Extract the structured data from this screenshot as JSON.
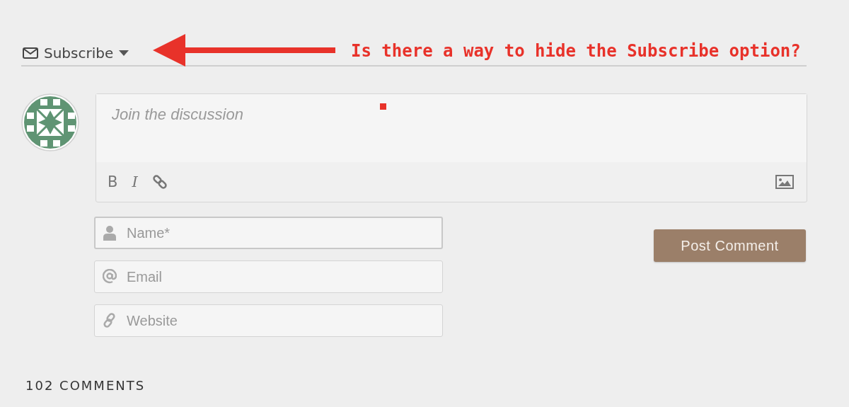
{
  "subscribe": {
    "label": "Subscribe"
  },
  "annotation": {
    "text": "Is there a way to hide the Subscribe option?"
  },
  "editor": {
    "placeholder": "Join the discussion",
    "toolbar": [
      {
        "kind": "bold",
        "label": "B"
      },
      {
        "kind": "italic",
        "label": "I"
      },
      {
        "kind": "link"
      }
    ]
  },
  "fields": [
    {
      "kind": "name",
      "placeholder": "Name*",
      "focused": true
    },
    {
      "kind": "email",
      "placeholder": "Email",
      "focused": false
    },
    {
      "kind": "website",
      "placeholder": "Website",
      "focused": false
    }
  ],
  "post_button": {
    "label": "Post Comment"
  },
  "comments_count": "102 COMMENTS"
}
